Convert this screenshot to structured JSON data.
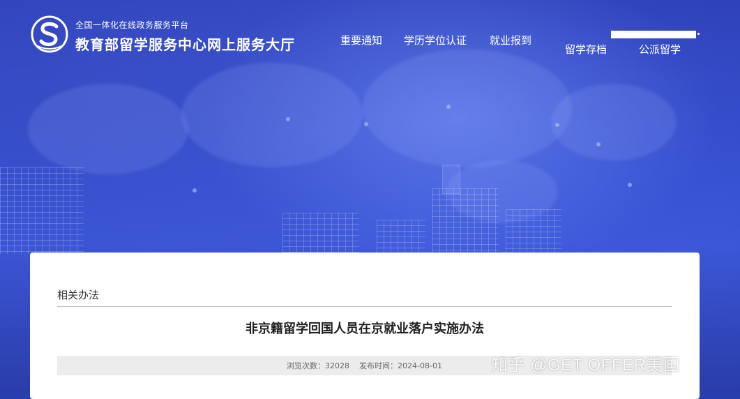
{
  "header": {
    "logo_icon": "service-center-s-logo-icon",
    "platform_subtitle": "全国一体化在线政务服务平台",
    "site_title": "教育部留学服务中心网上服务大厅",
    "nav": [
      {
        "label": "重要通知"
      },
      {
        "label": "学历学位认证"
      },
      {
        "label": "就业报到"
      },
      {
        "label": "留学存档"
      },
      {
        "label": "公派留学"
      }
    ]
  },
  "content": {
    "breadcrumb": "相关办法",
    "article_title": "非京籍留学回国人员在京就业落户实施办法",
    "meta": {
      "views_label": "浏览次数：",
      "views_value": "32028",
      "publish_label": "发布时间：",
      "publish_value": "2024-08-01"
    }
  },
  "watermark": "知乎 @GET OFFER美国",
  "colors": {
    "banner_blue": "#2d3fb7",
    "card_bg": "#ffffff",
    "meta_bg": "#ececec"
  }
}
